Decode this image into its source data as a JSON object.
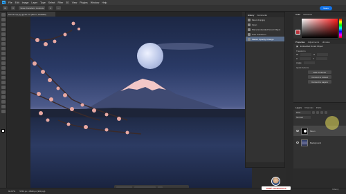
{
  "app": {
    "logo": "Ps"
  },
  "menu": [
    "File",
    "Edit",
    "Image",
    "Layer",
    "Type",
    "Select",
    "Filter",
    "3D",
    "View",
    "Plugins",
    "Window",
    "Help"
  ],
  "options": {
    "tool_value": "Show Transform Controls",
    "share_label": "Share"
  },
  "document": {
    "tab_title": "Mount Fuji.jpg @ 66.7% (Moon, RGB/8#)"
  },
  "history": {
    "tabs": [
      "History",
      "Comments"
    ],
    "items": [
      {
        "label": "Mount Fuji.jpg",
        "selected": false
      },
      {
        "label": "Open",
        "selected": false
      },
      {
        "label": "Place Embedded Smart Object",
        "selected": false
      },
      {
        "label": "Free Transform",
        "selected": false
      },
      {
        "label": "Master Opacity Change",
        "selected": true
      }
    ]
  },
  "color_panel": {
    "tabs": [
      "Color",
      "Swatches"
    ],
    "accent": "#b8323a"
  },
  "properties": {
    "tabs": [
      "Properties",
      "Adjustments",
      "Libraries"
    ],
    "title": "Embedded Smart Object",
    "transform_label": "Transform",
    "rows": [
      {
        "a": "W",
        "b": "H"
      },
      {
        "a": "X",
        "b": "Y"
      },
      {
        "a": "Angle",
        "b": ""
      }
    ],
    "quick_actions_label": "Quick Actions",
    "buttons": [
      "Edit Contents",
      "Convert to Linked",
      "Convert to Layers"
    ]
  },
  "layers": {
    "tabs": [
      "Layers",
      "Channels",
      "Paths"
    ],
    "kind": "Kind",
    "blend": "Normal",
    "items": [
      {
        "name": "Moon",
        "selected": true
      },
      {
        "name": "Background",
        "selected": false
      }
    ]
  },
  "context_bar": {
    "buttons": [
      "Select subject",
      "Remove background"
    ]
  },
  "status": {
    "zoom": "66.67%",
    "size": "5760 px x 3840 px (300 ppi)"
  },
  "watermark": {
    "name": "RENÉ FRANCESCHI",
    "brand": "Udemy"
  }
}
